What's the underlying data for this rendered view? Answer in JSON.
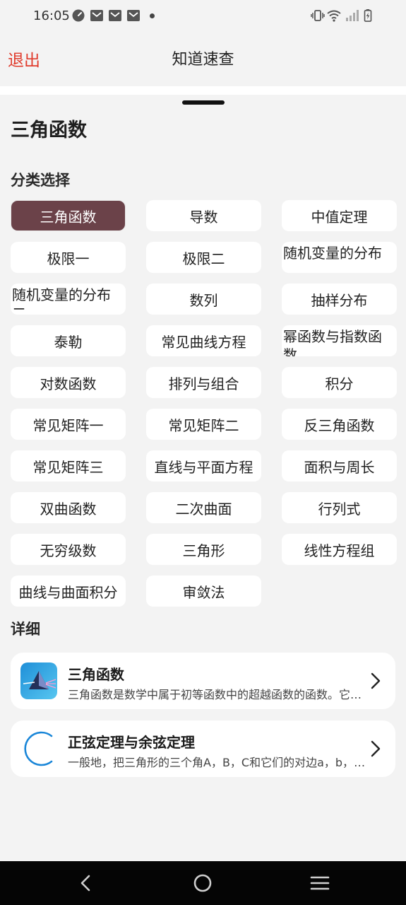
{
  "status_bar": {
    "time": "16:05",
    "left_icons": [
      "speedometer-icon",
      "mail-icon",
      "mail-icon",
      "mail-icon",
      "notification-dot-icon"
    ],
    "right_icons": [
      "vibrate-icon",
      "wifi-icon",
      "signal-icon",
      "battery-charging-icon"
    ]
  },
  "topbar": {
    "exit_label": "退出",
    "title": "知道速查"
  },
  "sheet": {
    "title": "三角函数",
    "category_label": "分类选择",
    "categories": [
      {
        "label": "三角函数",
        "selected": true
      },
      {
        "label": "导数"
      },
      {
        "label": "中值定理"
      },
      {
        "label": "极限一"
      },
      {
        "label": "极限二"
      },
      {
        "label": "随机变量的分布"
      },
      {
        "label": "随机变量的分布二"
      },
      {
        "label": "数列"
      },
      {
        "label": "抽样分布"
      },
      {
        "label": "泰勒"
      },
      {
        "label": "常见曲线方程"
      },
      {
        "label": "幂函数与指数函数"
      },
      {
        "label": "对数函数"
      },
      {
        "label": "排列与组合"
      },
      {
        "label": "积分"
      },
      {
        "label": "常见矩阵一"
      },
      {
        "label": "常见矩阵二"
      },
      {
        "label": "反三角函数"
      },
      {
        "label": "常见矩阵三"
      },
      {
        "label": "直线与平面方程"
      },
      {
        "label": "面积与周长"
      },
      {
        "label": "双曲函数"
      },
      {
        "label": "二次曲面"
      },
      {
        "label": "行列式"
      },
      {
        "label": "无穷级数"
      },
      {
        "label": "三角形"
      },
      {
        "label": "线性方程组"
      },
      {
        "label": "曲线与曲面积分"
      },
      {
        "label": "审敛法"
      }
    ],
    "detail_label": "详细",
    "details": [
      {
        "title": "三角函数",
        "desc": "三角函数是数学中属于初等函数中的超越函数的函数。它们的本质是任何角的集合与一个比值的集合的变量之间的映射。",
        "icon": "prism-icon"
      },
      {
        "title": "正弦定理与余弦定理",
        "desc": "一般地，把三角形的三个角A，B，C和它们的对边a，b，c叫做三角形的元素。",
        "icon": "arc-icon"
      }
    ]
  },
  "nav_bar": {
    "buttons": [
      "back-icon",
      "home-icon",
      "recents-icon"
    ]
  },
  "colors": {
    "accent_red": "#e03b2c",
    "selected_chip": "#6b4249",
    "background": "#f3f3f3",
    "card": "#ffffff"
  }
}
